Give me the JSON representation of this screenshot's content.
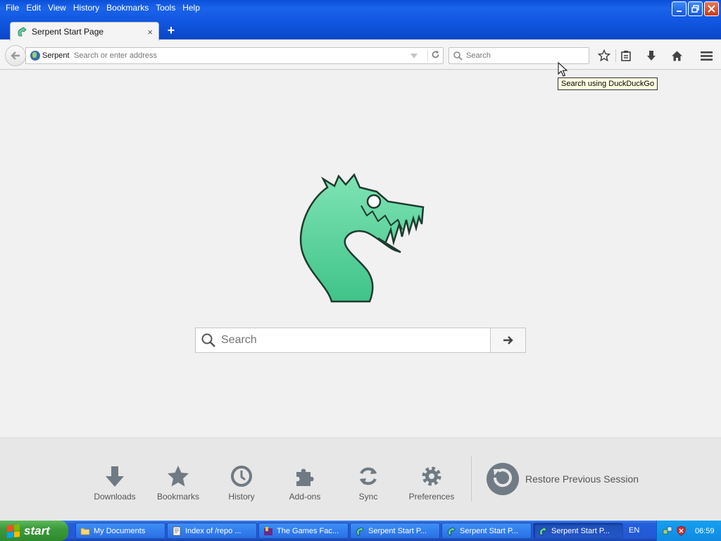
{
  "menu": [
    {
      "key": "F",
      "rest": "ile"
    },
    {
      "key": "E",
      "rest": "dit"
    },
    {
      "key": "V",
      "rest": "iew"
    },
    {
      "key": "",
      "pre": "Hi",
      "k2": "s",
      "rest": "tory"
    },
    {
      "key": "B",
      "rest": "ookmarks"
    },
    {
      "key": "T",
      "rest": "ools"
    },
    {
      "key": "H",
      "rest": "elp"
    }
  ],
  "menu_labels": [
    "File",
    "Edit",
    "View",
    "History",
    "Bookmarks",
    "Tools",
    "Help"
  ],
  "tab": {
    "title": "Serpent Start Page",
    "close": "×"
  },
  "newtab": "+",
  "urlbar": {
    "identity": "Serpent",
    "placeholder": "Search or enter address"
  },
  "searchbar": {
    "placeholder": "Search"
  },
  "tooltip": "Search using DuckDuckGo",
  "main_search": {
    "placeholder": "Search"
  },
  "launcher": {
    "items": [
      "Downloads",
      "Bookmarks",
      "History",
      "Add-ons",
      "Sync",
      "Preferences"
    ],
    "restore": "Restore Previous Session"
  },
  "taskbar": {
    "start": "start",
    "tasks": [
      "My Documents",
      "Index of /repo ...",
      "The Games Fac...",
      "Serpent Start P...",
      "Serpent Start P...",
      "Serpent Start P..."
    ],
    "lang": "EN",
    "clock": "06:59"
  },
  "colors": {
    "accent": "#5dd29e",
    "xp_blue": "#0b4fd8",
    "start_green": "#3c9a3c"
  }
}
